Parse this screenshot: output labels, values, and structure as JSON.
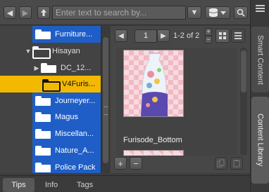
{
  "toolbar": {
    "search_placeholder": "Enter text to search by..."
  },
  "side_tabs": [
    {
      "label": "Smart Content",
      "active": false
    },
    {
      "label": "Content Library",
      "active": true
    }
  ],
  "tree": {
    "items": [
      {
        "label": "Furniture...",
        "level": 2,
        "selected_style": "blue"
      },
      {
        "label": "Hisayan",
        "level": 1,
        "expanded": true
      },
      {
        "label": "DC_12...",
        "level": 2,
        "collapsed": true
      },
      {
        "label": "V4Furis...",
        "level": 3,
        "selected": true
      },
      {
        "label": "Journeyer...",
        "level": 2,
        "selected_style": "blue"
      },
      {
        "label": "Magus",
        "level": 2,
        "selected_style": "blue"
      },
      {
        "label": "Miscellan...",
        "level": 2,
        "selected_style": "blue"
      },
      {
        "label": "Nature_A...",
        "level": 2,
        "selected_style": "blue"
      },
      {
        "label": "Police Pack",
        "level": 2,
        "selected_style": "blue"
      }
    ]
  },
  "pager": {
    "current_page": "1",
    "range_text": "1-2 of 2"
  },
  "assets": [
    {
      "label": "Furisode_Bottom"
    },
    {
      "label": ""
    }
  ],
  "bottom_tabs": [
    {
      "label": "Tips",
      "active": true
    },
    {
      "label": "Info",
      "active": false
    },
    {
      "label": "Tags",
      "active": false
    }
  ],
  "colors": {
    "selection_yellow": "#f3b800",
    "folder_blue": "#1f5ec7",
    "panel_bg": "#3d3d3d"
  }
}
